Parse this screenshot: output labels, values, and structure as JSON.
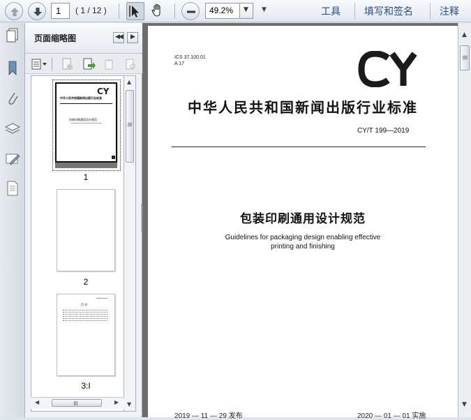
{
  "toolbar": {
    "page_current": "1",
    "page_count": "( 1 / 12 )",
    "zoom": "49.2%",
    "right_buttons": [
      "工具",
      "填写和签名",
      "注释"
    ]
  },
  "panel": {
    "title": "页面缩略图",
    "thumbnails": [
      {
        "label": "1",
        "mini_title": "中华人民共和国新闻出版行业标准",
        "mini_subtitle": "包装印刷通用设计规范"
      },
      {
        "label": "2"
      },
      {
        "label": "3:I",
        "mini_heading": "目  次"
      }
    ]
  },
  "document": {
    "ics_line1": "ICS 37.100.01",
    "ics_line2": "A 17",
    "logo": "CY",
    "standard_title": "中华人民共和国新闻出版行业标准",
    "standard_number": "CY/T 199—2019",
    "doc_title": "包装印刷通用设计规范",
    "doc_en_line1": "Guidelines for packaging design enabling effective",
    "doc_en_line2": "printing and finishing",
    "footer_left": "2019 — 11 — 29 发布",
    "footer_right": "2020 — 01 — 01 实施"
  },
  "colors": {
    "accent_text": "#2a4d86",
    "viewport_bg": "#6d6d6d"
  }
}
